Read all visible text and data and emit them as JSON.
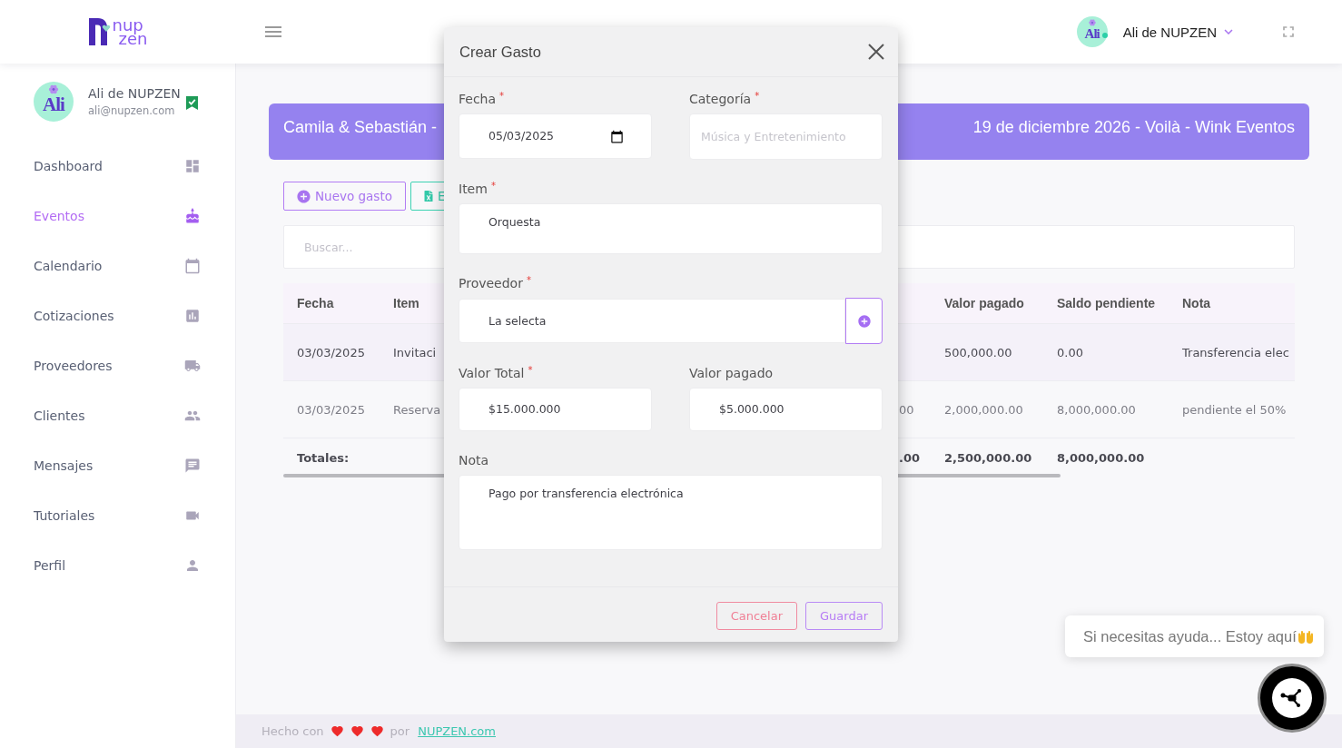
{
  "header": {
    "logo": {
      "line_1": "nup",
      "line_2": "zen"
    },
    "user": {
      "avatar_text": "Ali",
      "name": "Ali de NUPZEN"
    }
  },
  "sidebar": {
    "profile": {
      "avatar_text": "Ali",
      "name": "Ali de NUPZEN",
      "email": "ali@nupzen.com",
      "verified": true
    },
    "items": [
      {
        "label": "Dashboard",
        "selected": false
      },
      {
        "label": "Eventos",
        "selected": true
      },
      {
        "label": "Calendario",
        "selected": false
      },
      {
        "label": "Cotizaciones",
        "selected": false
      },
      {
        "label": "Proveedores",
        "selected": false
      },
      {
        "label": "Clientes",
        "selected": false
      },
      {
        "label": "Mensajes",
        "selected": false
      },
      {
        "label": "Tutoriales",
        "selected": false
      },
      {
        "label": "Perfil",
        "selected": false
      }
    ]
  },
  "event_banner": {
    "title": "Camila & Sebastián -",
    "details": "19 de diciembre 2026 - Voilà - Wink Eventos"
  },
  "actions": [
    {
      "kind": "add",
      "label": "Nuevo gasto"
    },
    {
      "kind": "export",
      "label": "E"
    }
  ],
  "search": {
    "placeholder": "Buscar..."
  },
  "table": {
    "columns": {
      "fecha": "Fecha",
      "item": "Item",
      "valor_pagado": "Valor pagado",
      "saldo_pendiente": "Saldo pendiente",
      "nota": "Nota"
    },
    "rows": [
      {
        "highlighted": true,
        "fecha": "03/03/2025",
        "item": "Invitaci",
        "valor_pagado": "500,000.00",
        "saldo_pendiente": "0.00",
        "nota": "Transferencia elec"
      },
      {
        "highlighted": false,
        "fecha": "03/03/2025",
        "item": "Reserva",
        "column_3": "00",
        "valor_pagado": "2,000,000.00",
        "saldo_pendiente": "8,000,000.00",
        "nota": "pendiente el 50%"
      }
    ],
    "totals": {
      "fecha": "Totales:",
      "column_3": ".00",
      "valor_pagado": "2,500,000.00",
      "saldo_pendiente": "8,000,000.00"
    }
  },
  "modal": {
    "title": "Crear Gasto",
    "fields": [
      {
        "kind": "date",
        "label": "Fecha",
        "required_mark": "*",
        "value": "05/03/2025"
      },
      {
        "kind": "select",
        "label": "Categoría",
        "required_mark": "*",
        "placeholder": "Música y Entretenimiento"
      },
      {
        "kind": "text",
        "label": "Item",
        "required_mark": "*",
        "value": "Orquesta"
      },
      {
        "kind": "lookup",
        "label": "Proveedor",
        "required_mark": "*",
        "value": "La selecta"
      },
      {
        "kind": "money",
        "label": "Valor Total",
        "required_mark": "*",
        "value": "$15.000.000"
      },
      {
        "kind": "money",
        "label": "Valor pagado",
        "value": "$5.000.000"
      },
      {
        "kind": "textarea",
        "label": "Nota",
        "value": "Pago por transferencia electrónica"
      }
    ],
    "buttons": [
      {
        "kind": "cancel",
        "label": "Cancelar"
      },
      {
        "kind": "save",
        "label": "Guardar"
      }
    ]
  },
  "footer": {
    "text_1": "Hecho con",
    "text_2": "por",
    "link": "NUPZEN.com"
  },
  "chat": {
    "message": "Si necesitas ayuda... Estoy aquí"
  }
}
